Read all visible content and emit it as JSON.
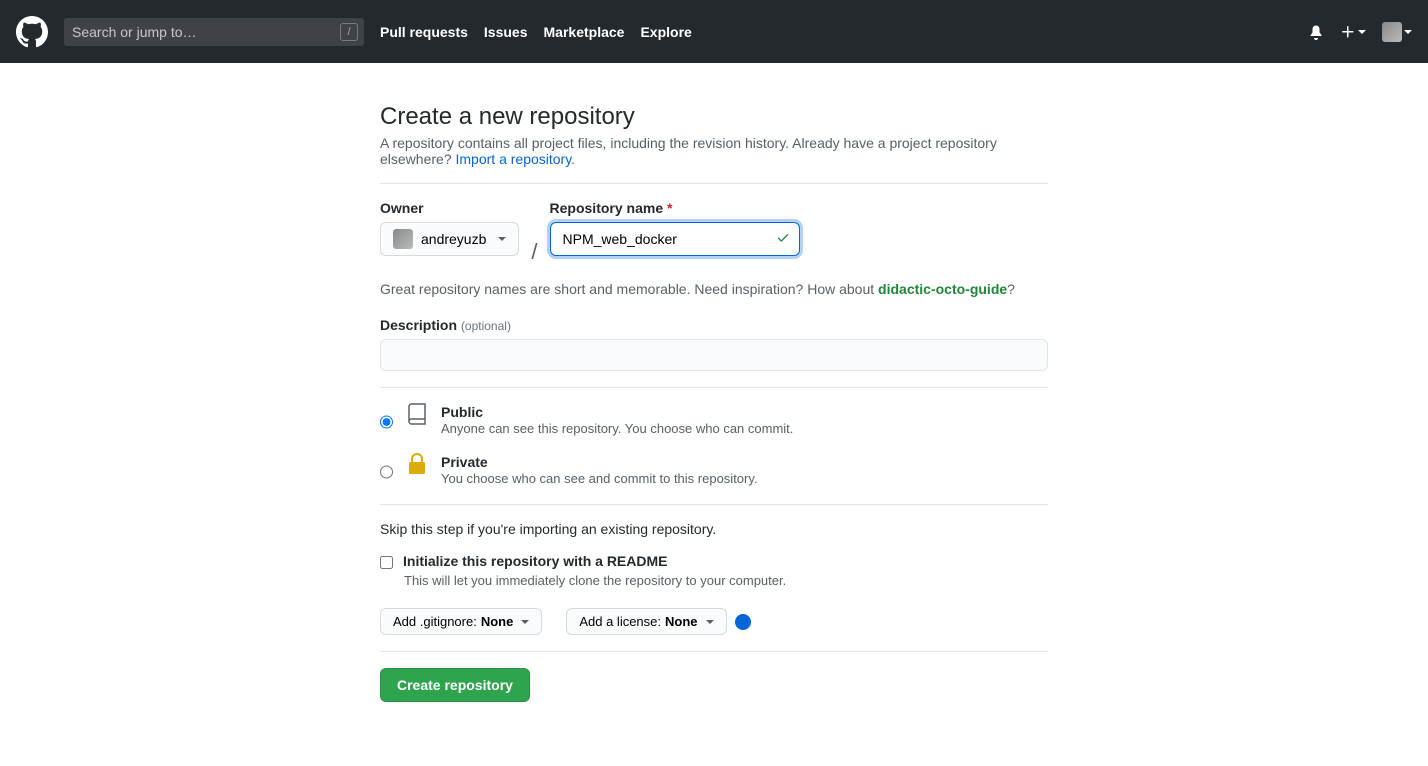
{
  "header": {
    "search_placeholder": "Search or jump to…",
    "nav": {
      "pull_requests": "Pull requests",
      "issues": "Issues",
      "marketplace": "Marketplace",
      "explore": "Explore"
    }
  },
  "page": {
    "title": "Create a new repository",
    "subtitle_1": "A repository contains all project files, including the revision history. Already have a project repository elsewhere? ",
    "import_link": "Import a repository",
    "period": "."
  },
  "form": {
    "owner_label": "Owner",
    "owner_value": "andreyuzb",
    "repo_label": "Repository name",
    "repo_value": "NPM_web_docker",
    "name_hint_1": "Great repository names are short and memorable. Need inspiration? How about ",
    "name_suggestion": "didactic-octo-guide",
    "name_hint_2": "?",
    "desc_label": "Description",
    "desc_optional": "(optional)",
    "desc_value": "",
    "visibility": {
      "public_label": "Public",
      "public_desc": "Anyone can see this repository. You choose who can commit.",
      "private_label": "Private",
      "private_desc": "You choose who can see and commit to this repository."
    },
    "skip_note": "Skip this step if you're importing an existing repository.",
    "readme_label": "Initialize this repository with a README",
    "readme_desc": "This will let you immediately clone the repository to your computer.",
    "gitignore_prefix": "Add .gitignore: ",
    "gitignore_value": "None",
    "license_prefix": "Add a license: ",
    "license_value": "None",
    "submit_label": "Create repository"
  }
}
